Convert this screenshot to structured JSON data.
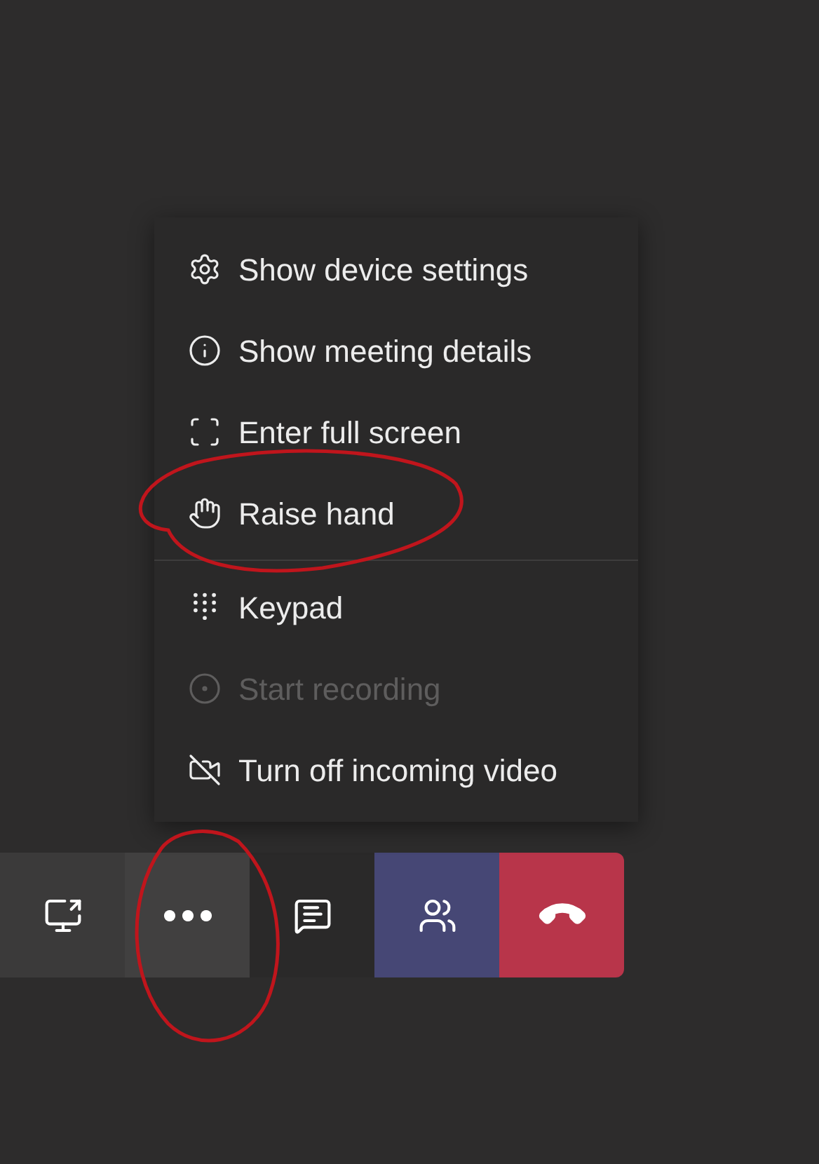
{
  "menu": {
    "items": [
      {
        "label": "Show device settings",
        "kind": "settings",
        "disabled": false,
        "separator_before": false,
        "annotated": false
      },
      {
        "label": "Show meeting details",
        "kind": "info",
        "disabled": false,
        "separator_before": false,
        "annotated": false
      },
      {
        "label": "Enter full screen",
        "kind": "fullscreen",
        "disabled": false,
        "separator_before": false,
        "annotated": false
      },
      {
        "label": "Raise hand",
        "kind": "hand",
        "disabled": false,
        "separator_before": false,
        "annotated": true
      },
      {
        "label": "Keypad",
        "kind": "keypad",
        "disabled": false,
        "separator_before": true,
        "annotated": false
      },
      {
        "label": "Start recording",
        "kind": "record",
        "disabled": true,
        "separator_before": false,
        "annotated": false
      },
      {
        "label": "Turn off incoming video",
        "kind": "video_off",
        "disabled": false,
        "separator_before": false,
        "annotated": false
      }
    ]
  },
  "toolbar": {
    "buttons": [
      {
        "kind": "share",
        "selected": false,
        "annotated": false
      },
      {
        "kind": "more",
        "selected": true,
        "annotated": true
      },
      {
        "kind": "chat",
        "selected": false,
        "annotated": false
      },
      {
        "kind": "people",
        "selected": false,
        "annotated": false
      },
      {
        "kind": "hangup",
        "selected": false,
        "annotated": false
      }
    ]
  }
}
